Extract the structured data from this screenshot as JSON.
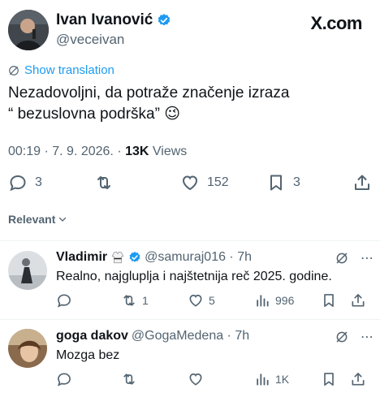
{
  "tweet": {
    "author_name": "Ivan Ivanović",
    "author_handle": "@veceivan",
    "site_logo": "X.com",
    "translate_label": "Show translation",
    "text_line1": "Nezadovoljni, da potraže značenje izraza",
    "text_line2": "“ bezuslovna podrška” 😉",
    "time": "00:19 · 7. 9. 2026. · ",
    "views_count": "13K",
    "views_label": " Views",
    "actions": {
      "replies": "3",
      "likes": "152",
      "bookmarks": "3"
    },
    "icons": [
      "reply-icon",
      "retweet-icon",
      "like-icon",
      "bookmark-icon",
      "share-icon"
    ]
  },
  "sort": {
    "label": "Relevant"
  },
  "replies": [
    {
      "name": "Vladimir",
      "handle": "@samuraj016 · 7h",
      "text": "Realno, najgluplja i najštetnija reč 2025. godine.",
      "replies": "",
      "retweets": "1",
      "likes": "5",
      "views": "996"
    },
    {
      "name": "goga dakov",
      "handle": "@GogaMedena · 7h",
      "text": "Mozga bez",
      "replies": "",
      "retweets": "",
      "likes": "",
      "views": "1K"
    }
  ],
  "colors": {
    "accent": "#1d9bf0",
    "text": "#0f1419",
    "muted": "#536471",
    "verified": "#1d9bf0",
    "divider": "#eff3f4"
  }
}
